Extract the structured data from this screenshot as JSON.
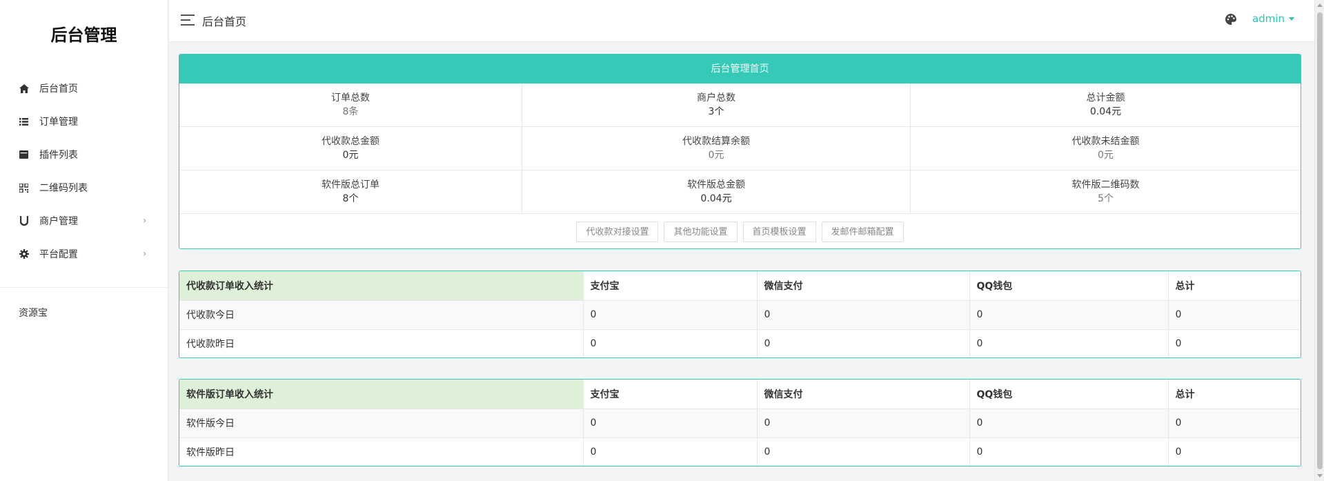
{
  "sidebar": {
    "brand": "后台管理",
    "items": [
      {
        "label": "后台首页",
        "icon": "home-icon"
      },
      {
        "label": "订单管理",
        "icon": "list-icon"
      },
      {
        "label": "插件列表",
        "icon": "plugin-icon"
      },
      {
        "label": "二维码列表",
        "icon": "qrcode-icon"
      },
      {
        "label": "商户管理",
        "icon": "magnet-icon",
        "chevron": "›"
      },
      {
        "label": "平台配置",
        "icon": "gear-icon",
        "chevron": "›"
      }
    ],
    "extra": "资源宝"
  },
  "header": {
    "title": "后台首页",
    "user": "admin"
  },
  "panel": {
    "title": "后台管理首页",
    "stats": [
      {
        "label": "订单总数",
        "value": "8条"
      },
      {
        "label": "商户总数",
        "value": "3个"
      },
      {
        "label": "总计金额",
        "value": "0.04元"
      },
      {
        "label": "代收款总金额",
        "value": "0元"
      },
      {
        "label": "代收款结算余额",
        "value": "0元"
      },
      {
        "label": "代收款未结金额",
        "value": "0元"
      },
      {
        "label": "软件版总订单",
        "value": "8个"
      },
      {
        "label": "软件版总金额",
        "value": "0.04元"
      },
      {
        "label": "软件版二维码数",
        "value": "5个"
      }
    ],
    "buttons": [
      "代收款对接设置",
      "其他功能设置",
      "首页模板设置",
      "发邮件邮箱配置"
    ]
  },
  "table1": {
    "headers": [
      "代收款订单收入统计",
      "支付宝",
      "微信支付",
      "QQ钱包",
      "总计"
    ],
    "rows": [
      [
        "代收款今日",
        "0",
        "0",
        "0",
        "0"
      ],
      [
        "代收款昨日",
        "0",
        "0",
        "0",
        "0"
      ]
    ]
  },
  "table2": {
    "headers": [
      "软件版订单收入统计",
      "支付宝",
      "微信支付",
      "QQ钱包",
      "总计"
    ],
    "rows": [
      [
        "软件版今日",
        "0",
        "0",
        "0",
        "0"
      ],
      [
        "软件版昨日",
        "0",
        "0",
        "0",
        "0"
      ]
    ]
  },
  "colors": {
    "accent": "#36c9b8",
    "header_cell": "#dff0d8"
  }
}
